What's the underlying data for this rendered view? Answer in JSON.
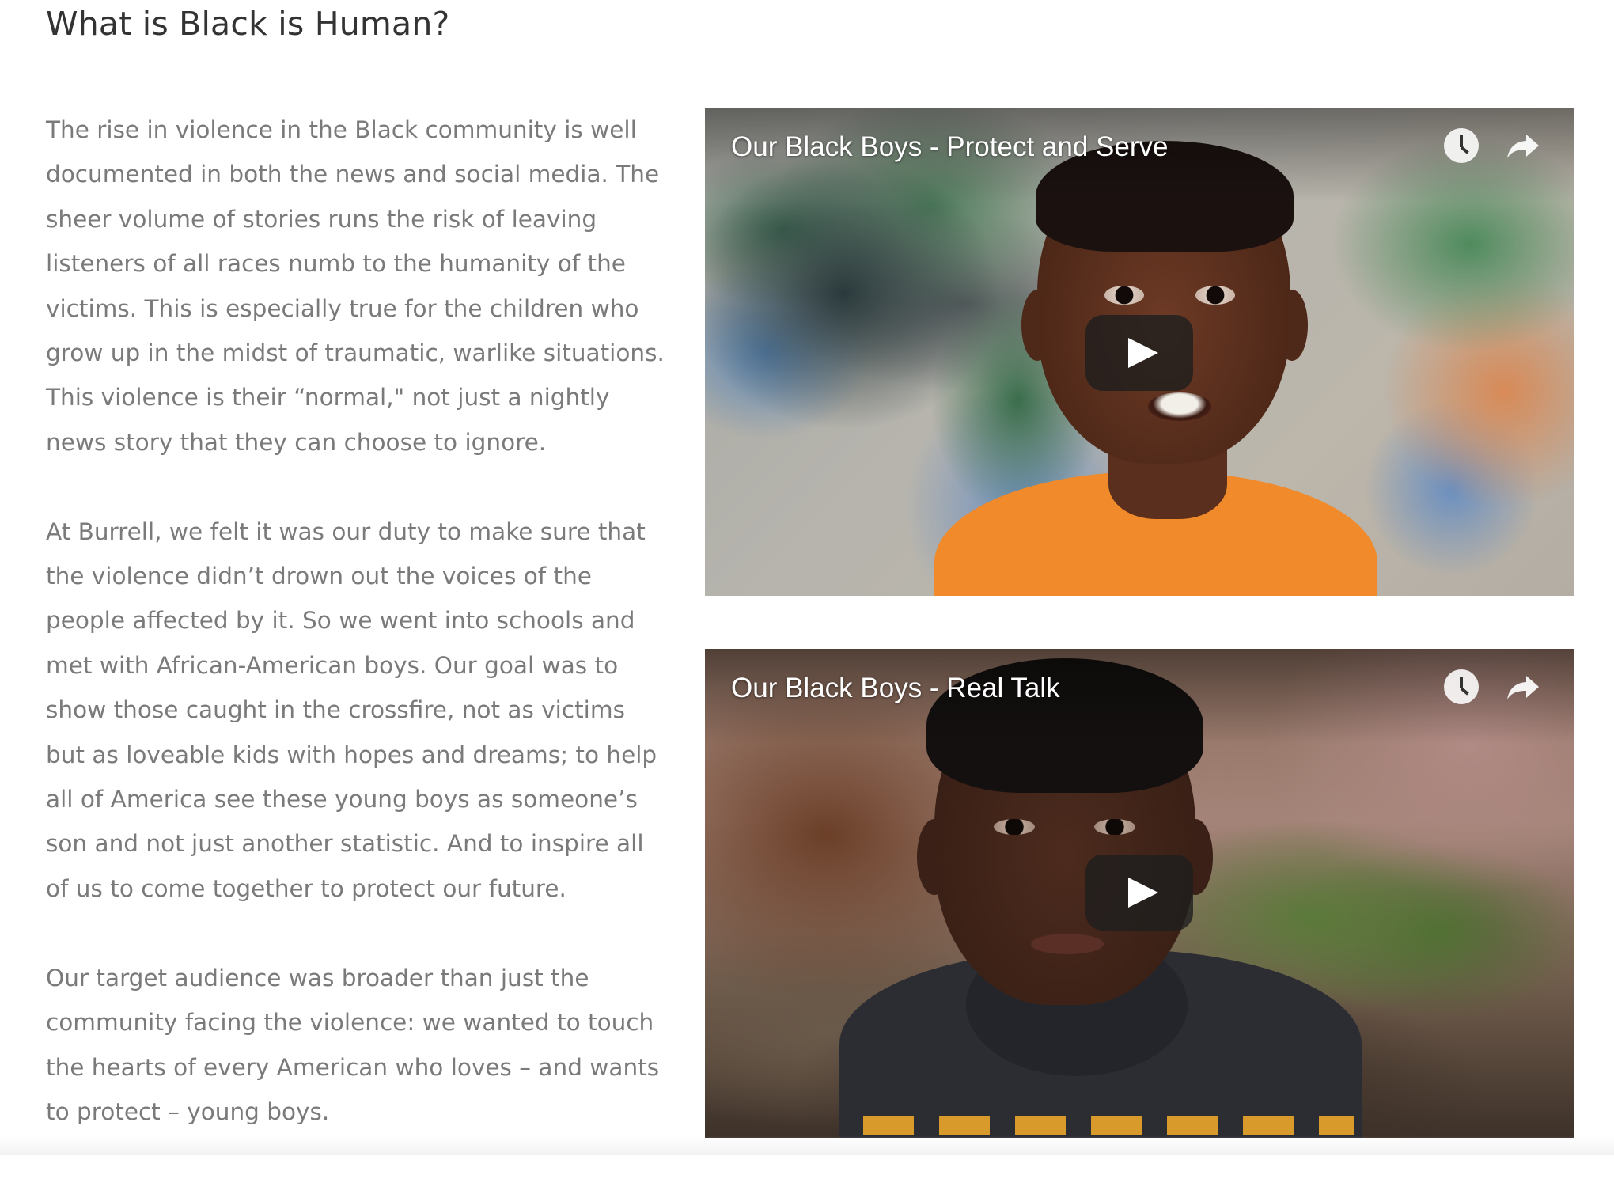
{
  "page": {
    "title": "What is Black is Human?"
  },
  "article": {
    "paragraphs": [
      "The rise in violence in the Black community is well documented in both the news and social media. The sheer volume of stories runs the risk of leaving listeners of all races numb to the humanity of the victims. This is especially true for the children who grow up in the midst of traumatic, warlike situations. This violence is their “normal,\" not just a nightly news story that they can choose to ignore.",
      "At Burrell, we felt it was our duty to make sure that the violence didn’t drown out the voices of the people affected by it. So we went into schools and met with African-American boys. Our goal was to show those caught in the crossfire, not as victims but as loveable kids with hopes and dreams; to help all of America see these young boys as someone’s son and not just another statistic.  And to inspire all of us to come together to protect our future.",
      "Our target audience was broader than just the community facing the violence: we wanted to touch the hearts of every American who loves – and wants to protect – young boys."
    ]
  },
  "videos": [
    {
      "title": "Our Black Boys - Protect and Serve",
      "controls": {
        "watch_later_icon": "clock-icon",
        "share_icon": "share-icon",
        "play_icon": "play-icon"
      }
    },
    {
      "title": "Our Black Boys - Real Talk",
      "controls": {
        "watch_later_icon": "clock-icon",
        "share_icon": "share-icon",
        "play_icon": "play-icon"
      }
    }
  ],
  "colors": {
    "title_text": "#333333",
    "body_text": "#7a7a7a",
    "video_overlay_text": "#ffffff"
  }
}
